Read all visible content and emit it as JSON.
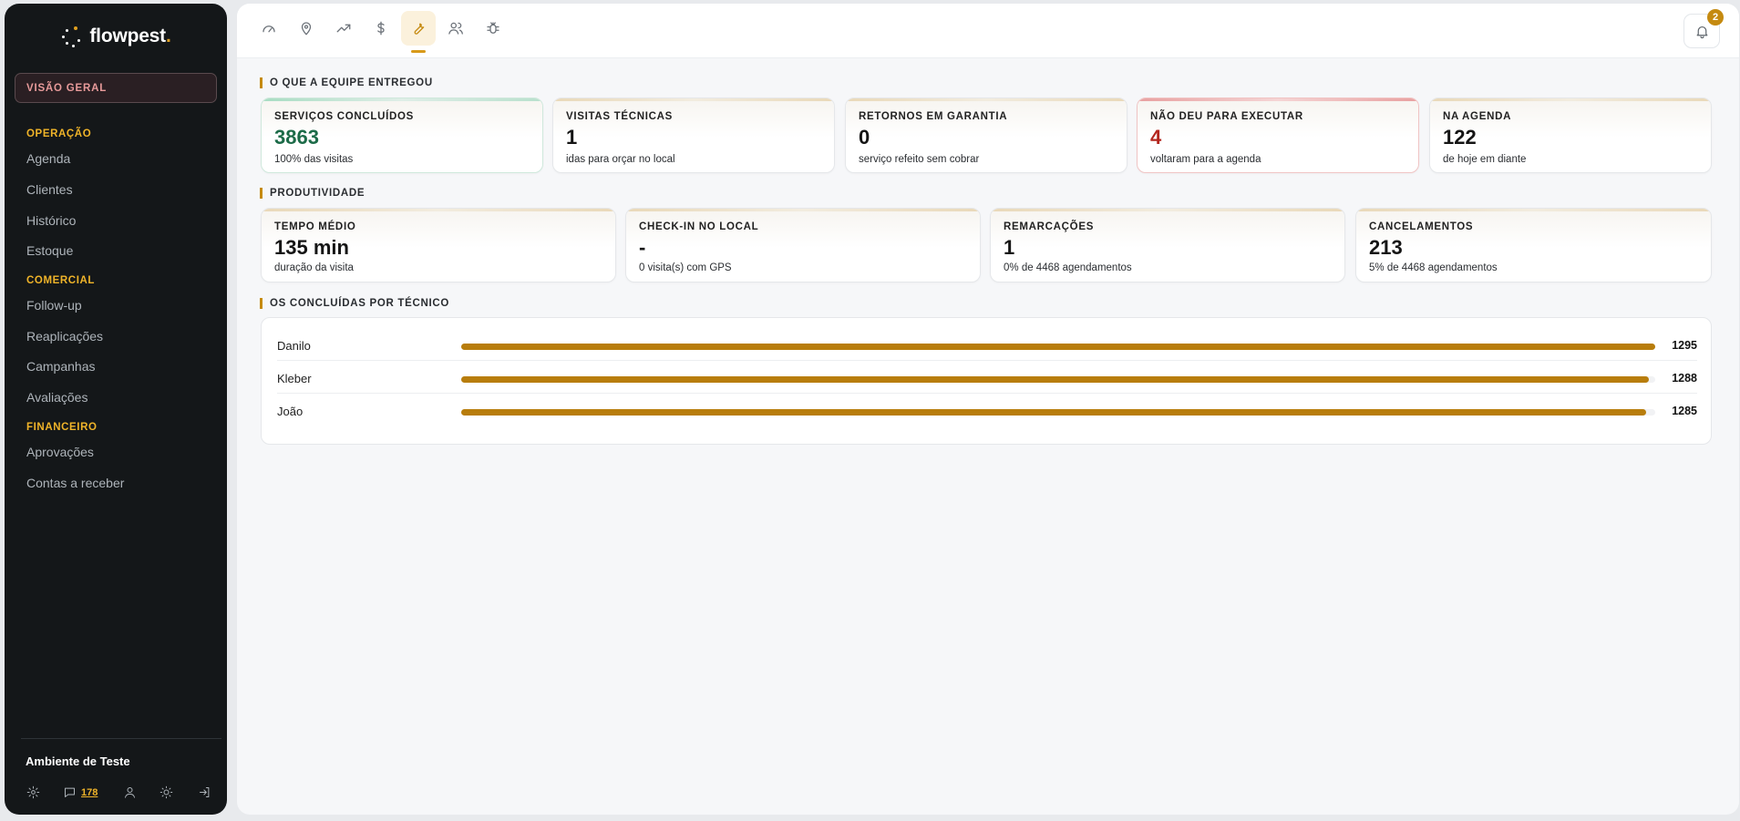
{
  "brand": {
    "name": "flowpest",
    "dot": ".",
    "accent": "#e0a020"
  },
  "sidebar": {
    "overview": "VISÃO GERAL",
    "sections": [
      {
        "title": "OPERAÇÃO",
        "items": [
          "Agenda",
          "Clientes",
          "Histórico",
          "Estoque"
        ]
      },
      {
        "title": "COMERCIAL",
        "items": [
          "Follow-up",
          "Reaplicações",
          "Campanhas",
          "Avaliações"
        ]
      },
      {
        "title": "FINANCEIRO",
        "items": [
          "Aprovações",
          "Contas a receber"
        ]
      }
    ],
    "environment": "Ambiente de Teste",
    "footer": {
      "chat_count": "178",
      "icons": [
        "settings-icon",
        "chat-icon",
        "user-icon",
        "sun-icon",
        "logout-icon"
      ]
    }
  },
  "topbar": {
    "icons": [
      "gauge-icon",
      "map-pin-icon",
      "trending-up-icon",
      "dollar-icon",
      "wrench-icon",
      "users-icon",
      "bug-icon"
    ],
    "active": "wrench-icon",
    "notifications": "2"
  },
  "delivered": {
    "label": "O QUE A EQUIPE ENTREGOU",
    "cards": [
      {
        "title": "SERVIÇOS CONCLUÍDOS",
        "value": "3863",
        "sub": "100% das visitas",
        "tone": "green"
      },
      {
        "title": "VISITAS TÉCNICAS",
        "value": "1",
        "sub": "idas para orçar no local",
        "tone": "neutral"
      },
      {
        "title": "RETORNOS EM GARANTIA",
        "value": "0",
        "sub": "serviço refeito sem cobrar",
        "tone": "neutral"
      },
      {
        "title": "NÃO DEU PARA EXECUTAR",
        "value": "4",
        "sub": "voltaram para a agenda",
        "tone": "red"
      },
      {
        "title": "NA AGENDA",
        "value": "122",
        "sub": "de hoje em diante",
        "tone": "neutral"
      }
    ]
  },
  "productivity": {
    "label": "PRODUTIVIDADE",
    "cards": [
      {
        "title": "TEMPO MÉDIO",
        "value": "135 min",
        "sub": "duração da visita"
      },
      {
        "title": "CHECK-IN NO LOCAL",
        "value": "-",
        "sub": "0 visita(s) com GPS"
      },
      {
        "title": "REMARCAÇÕES",
        "value": "1",
        "sub": "0% de 4468 agendamentos"
      },
      {
        "title": "CANCELAMENTOS",
        "value": "213",
        "sub": "5% de 4468 agendamentos"
      }
    ]
  },
  "technicians": {
    "label": "OS CONCLUÍDAS POR TÉCNICO",
    "bar_color": "#b87d0c",
    "max": 1295,
    "rows": [
      {
        "name": "Danilo",
        "value": 1295
      },
      {
        "name": "Kleber",
        "value": 1288
      },
      {
        "name": "João",
        "value": 1285
      }
    ]
  }
}
